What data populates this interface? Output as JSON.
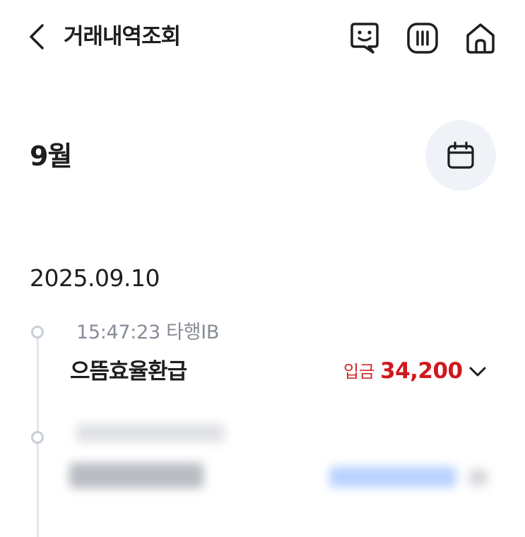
{
  "header": {
    "title": "거래내역조회",
    "icons": [
      "back-icon",
      "chatbot-icon",
      "menu-bars-icon",
      "home-icon"
    ]
  },
  "month": {
    "label": "9월",
    "calendar_icon": "calendar-icon"
  },
  "date_group": {
    "date": "2025.09.10"
  },
  "transactions": [
    {
      "time": "15:47:23 타행IB",
      "name": "으뜸효율환급",
      "type": "입금",
      "amount": "34,200",
      "type_color": "#d22b2b"
    }
  ],
  "colors": {
    "deposit": "#d0191d",
    "calendar_bg": "#eff3f8",
    "blurred_amount": "#b9d3ff"
  }
}
